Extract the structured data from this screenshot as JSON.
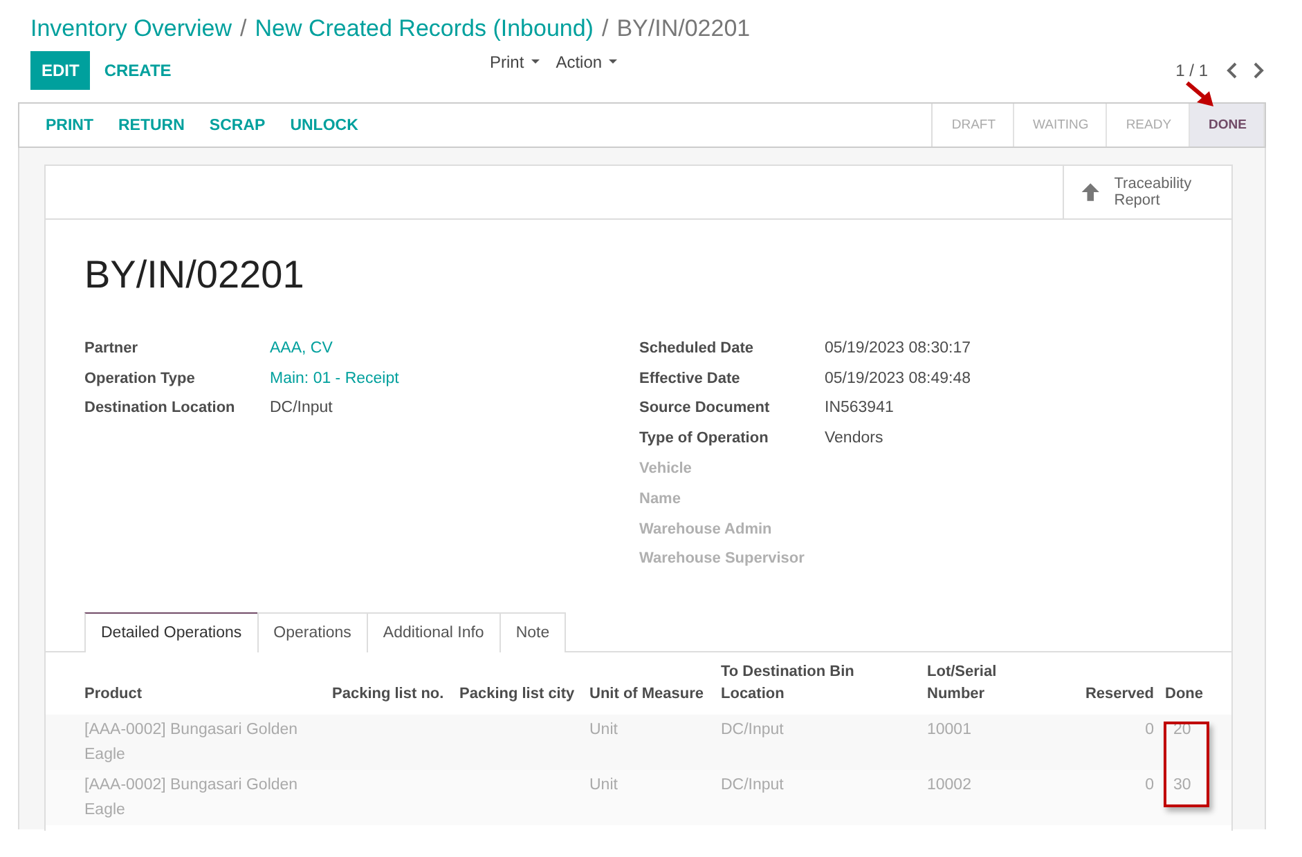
{
  "breadcrumb": [
    {
      "label": "Inventory Overview",
      "kind": "link"
    },
    {
      "label": "New Created Records (Inbound)",
      "kind": "link"
    },
    {
      "label": "BY/IN/02201",
      "kind": "current"
    }
  ],
  "breadcrumb_separator": "/",
  "buttons": [
    {
      "label": "EDIT",
      "kind": "primary"
    },
    {
      "label": "CREATE",
      "kind": "secondary"
    }
  ],
  "dropdowns": [
    "Print",
    "Action"
  ],
  "pager": "1 / 1",
  "actions": [
    "PRINT",
    "RETURN",
    "SCRAP",
    "UNLOCK"
  ],
  "stages": [
    {
      "label": "DRAFT",
      "selected": false
    },
    {
      "label": "WAITING",
      "selected": false
    },
    {
      "label": "READY",
      "selected": false
    },
    {
      "label": "DONE",
      "selected": true
    }
  ],
  "smart_button": {
    "label": "Traceability Report"
  },
  "record_title": "BY/IN/02201",
  "left_fields": [
    {
      "label": "Partner",
      "value": "AAA, CV",
      "kind": "link",
      "muted": false
    },
    {
      "label": "Operation Type",
      "value": "Main: 01 - Receipt",
      "kind": "link",
      "muted": false
    },
    {
      "label": "Destination Location",
      "value": "DC/Input",
      "kind": "text",
      "muted": false
    }
  ],
  "right_fields": [
    {
      "label": "Scheduled Date",
      "value": "05/19/2023 08:30:17",
      "muted": false
    },
    {
      "label": "Effective Date",
      "value": "05/19/2023 08:49:48",
      "muted": false
    },
    {
      "label": "Source Document",
      "value": "IN563941",
      "muted": false
    },
    {
      "label": "Type of Operation",
      "value": "Vendors",
      "muted": false
    },
    {
      "label": "Vehicle",
      "muted": true
    },
    {
      "label": "Name",
      "muted": true
    },
    {
      "label": "Warehouse Admin",
      "muted": true
    },
    {
      "label": "Warehouse Supervisor",
      "muted": true
    }
  ],
  "tabs": [
    {
      "label": "Detailed Operations",
      "selected": true
    },
    {
      "label": "Operations",
      "selected": false
    },
    {
      "label": "Additional Info",
      "selected": false
    },
    {
      "label": "Note",
      "selected": false
    }
  ],
  "table": {
    "columns": [
      "Product",
      "Packing list no.",
      "Packing list city",
      "Unit of Measure",
      "To Destination Bin Location",
      "Lot/Serial Number",
      "Reserved",
      "Done"
    ],
    "rows": [
      {
        "cells": [
          "[AAA-0002] Bungasari Golden Eagle",
          "",
          "",
          "Unit",
          "DC/Input",
          "10001",
          "0",
          "20"
        ]
      },
      {
        "cells": [
          "[AAA-0002] Bungasari Golden Eagle",
          "",
          "",
          "Unit",
          "DC/Input",
          "10002",
          "0",
          "30"
        ]
      }
    ]
  }
}
